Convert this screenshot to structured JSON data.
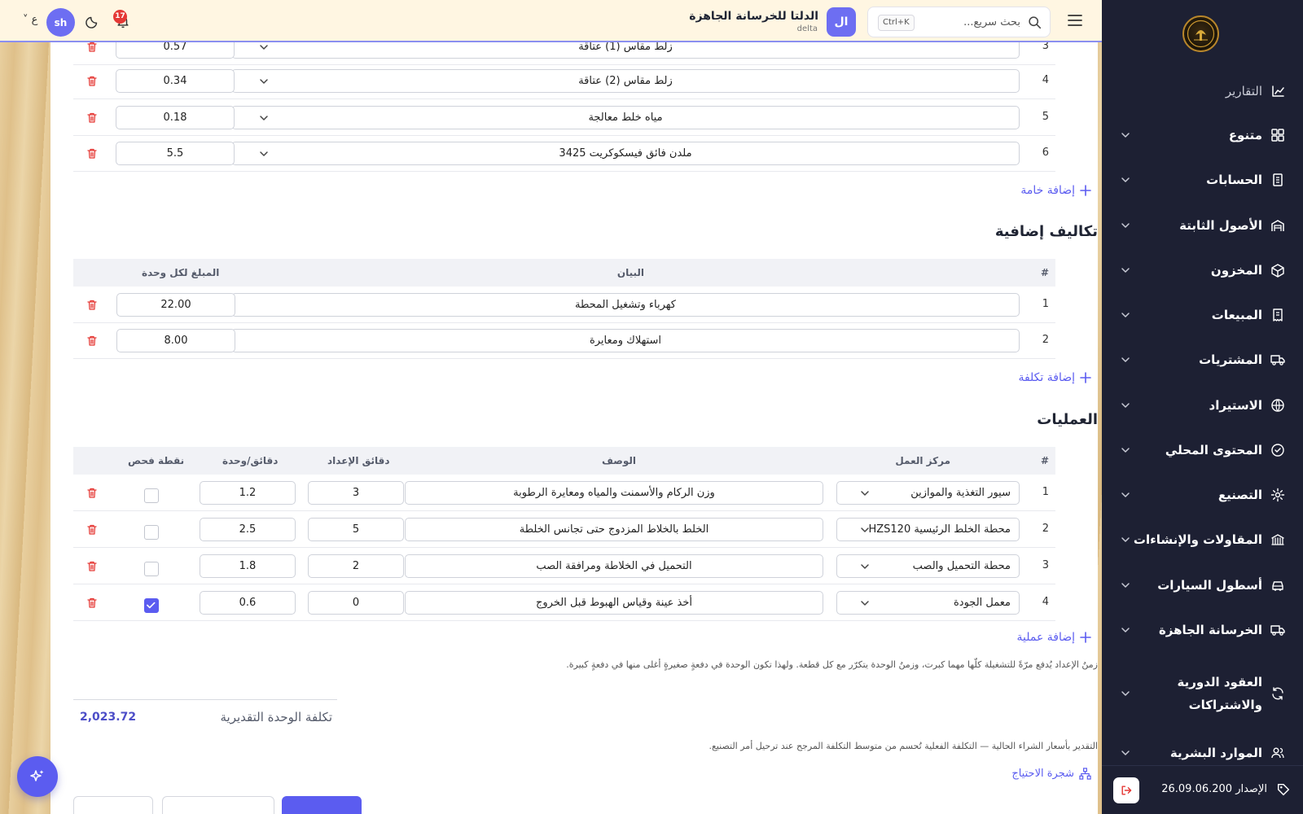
{
  "topbar": {
    "search_placeholder": "بحث سريع...",
    "search_shortcut": "Ctrl+K",
    "company_initials": "ال",
    "company_name": "الدلتا للخرسانة الجاهزة",
    "company_sub": "delta",
    "notification_count": "17",
    "user_initials": "sh",
    "language_label": "ع"
  },
  "sidebar": {
    "items": [
      {
        "label": "التقارير",
        "icon": "chart-line-icon"
      },
      {
        "label": "متنوع",
        "icon": "grid-icon"
      },
      {
        "label": "الحسابات",
        "icon": "ledger-icon"
      },
      {
        "label": "الأصول الثابتة",
        "icon": "warehouse-icon"
      },
      {
        "label": "المخزون",
        "icon": "box-icon"
      },
      {
        "label": "المبيعات",
        "icon": "receipt-icon"
      },
      {
        "label": "المشتريات",
        "icon": "truck-icon"
      },
      {
        "label": "الاستيراد",
        "icon": "globe-icon"
      },
      {
        "label": "المحتوى المحلي",
        "icon": "check-circle-icon"
      },
      {
        "label": "التصنيع",
        "icon": "gear-icon"
      },
      {
        "label": "المقاولات والإنشاءات",
        "icon": "bank-icon"
      },
      {
        "label": "أسطول السيارات",
        "icon": "car-icon"
      },
      {
        "label": "الخرسانة الجاهزة",
        "icon": "truck-icon"
      },
      {
        "label": "العقود الدورية والاشتراكات",
        "icon": "refresh-icon"
      },
      {
        "label": "الموارد البشرية",
        "icon": "users-icon"
      }
    ],
    "version": "الإصدار 26.09.06.200"
  },
  "materials": {
    "rows": [
      {
        "num": "3",
        "name": "زلط مقاس (1) عتاقة",
        "qty": "0.57"
      },
      {
        "num": "4",
        "name": "زلط مقاس (2) عتاقة",
        "qty": "0.34"
      },
      {
        "num": "5",
        "name": "مياه خلط معالجة",
        "qty": "0.18"
      },
      {
        "num": "6",
        "name": "ملدن فائق فيسكوكريت 3425",
        "qty": "5.5"
      }
    ],
    "add_label": "إضافة خامة"
  },
  "extra_costs": {
    "title": "تكاليف إضافية",
    "headers": {
      "num": "#",
      "desc": "البيان",
      "amount": "المبلغ لكل وحدة"
    },
    "rows": [
      {
        "num": "1",
        "desc": "كهرباء وتشغيل المحطة",
        "amount": "22.00"
      },
      {
        "num": "2",
        "desc": "استهلاك ومعايرة",
        "amount": "8.00"
      }
    ],
    "add_label": "إضافة تكلفة"
  },
  "operations": {
    "title": "العمليات",
    "headers": {
      "num": "#",
      "center": "مركز العمل",
      "desc": "الوصف",
      "setup": "دقائق الإعداد",
      "per_unit": "دقائق/وحدة",
      "check": "نقطة فحص"
    },
    "rows": [
      {
        "num": "1",
        "center": "سيور التغذية والموازين",
        "desc": "وزن الركام والأسمنت والمياه ومعايرة الرطوبة",
        "setup": "3",
        "per_unit": "1.2",
        "check": false
      },
      {
        "num": "2",
        "center": "محطة الخلط الرئيسية HZS120",
        "desc": "الخلط بالخلاط المزدوج حتى تجانس الخلطة",
        "setup": "5",
        "per_unit": "2.5",
        "check": false
      },
      {
        "num": "3",
        "center": "محطة التحميل والصب",
        "desc": "التحميل في الخلاطة ومرافقة الصب",
        "setup": "2",
        "per_unit": "1.8",
        "check": false
      },
      {
        "num": "4",
        "center": "معمل الجودة",
        "desc": "أخذ عينة وقياس الهبوط قبل الخروج",
        "setup": "0",
        "per_unit": "0.6",
        "check": true
      }
    ],
    "add_label": "إضافة عملية",
    "note": "زمنُ الإعداد يُدفع مرّةً للتشغيلة كلّها مهما كبرت، وزمنُ الوحدة يتكرّر مع كل قطعة. ولهذا تكون الوحدة في دفعةٍ صغيرةٍ أغلى منها في دفعةٍ كبيرة."
  },
  "cost": {
    "label": "تكلفة الوحدة التقديرية",
    "value": "2,023.72",
    "note": "التقدير بأسعار الشراء الحالية — التكلفة الفعلية تُحسم من متوسط التكلفة المرجح عند ترحيل أمر التصنيع.",
    "tree_label": "شجرة الاحتياج"
  },
  "colors": {
    "accent": "#5b5cf0",
    "sidebar_bg": "#1d2033",
    "danger": "#e53935"
  }
}
